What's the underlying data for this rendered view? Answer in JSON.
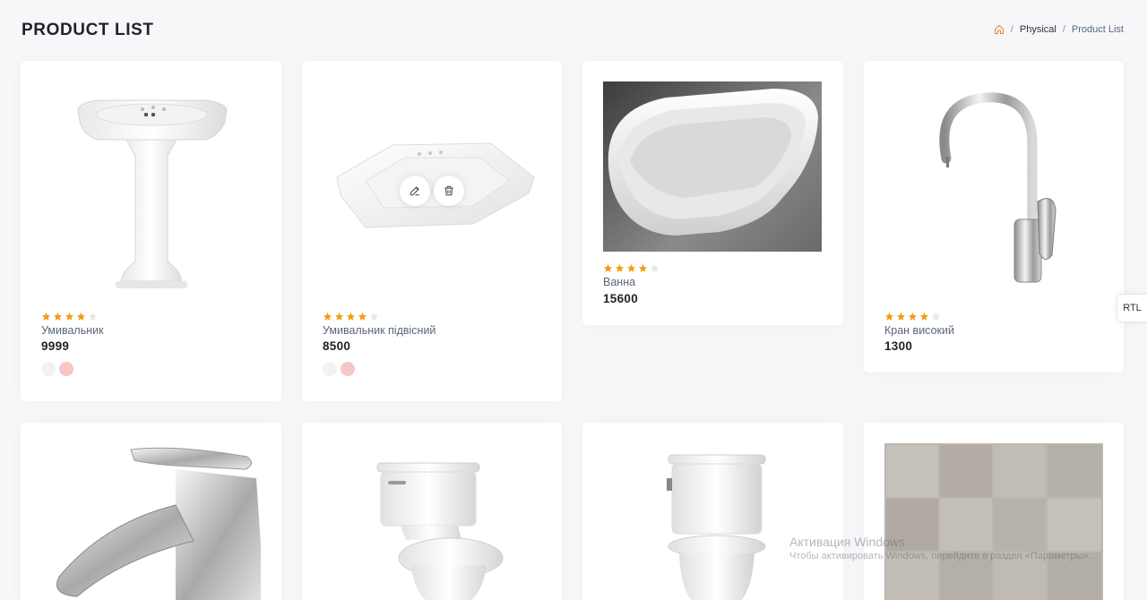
{
  "header": {
    "title": "PRODUCT LIST",
    "breadcrumb": {
      "home_icon": "home-icon",
      "items": [
        "Physical",
        "Product List"
      ]
    }
  },
  "colors": {
    "accent": "#f39c12",
    "star_empty": "#e6e6e6",
    "swatch_pink": "#f7c6c6",
    "swatch_light": "#f0f0f0"
  },
  "products": [
    {
      "name": "Умивальник",
      "price": "9999",
      "rating": 4
    },
    {
      "name": "Умивальник підвісний",
      "price": "8500",
      "rating": 4
    },
    {
      "name": "Ванна",
      "price": "15600",
      "rating": 4
    },
    {
      "name": "Кран високий",
      "price": "1300",
      "rating": 4
    }
  ],
  "rtl_label": "RTL",
  "watermark": {
    "line1": "Активация Windows",
    "line2": "Чтобы активировать Windows, перейдите в раздел «Параметры»."
  }
}
